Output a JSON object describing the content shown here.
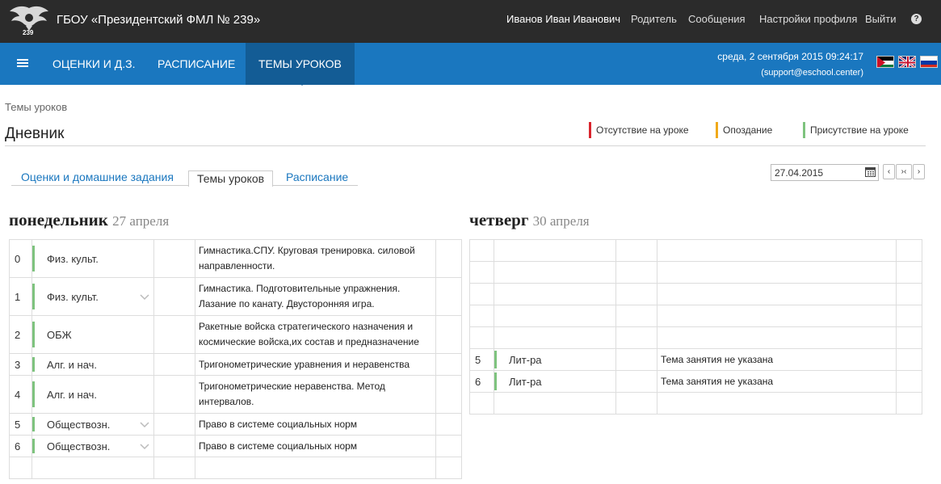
{
  "header": {
    "school_name": "ГБОУ «Президентский ФМЛ № 239»",
    "user_name": "Иванов Иван Иванович",
    "role": "Родитель",
    "messages": "Сообщения",
    "settings": "Настройки профиля",
    "logout": "Выйти",
    "help": "?",
    "logo_text": "239"
  },
  "nav": {
    "items": [
      "ОЦЕНКИ И Д.З.",
      "РАСПИСАНИЕ",
      "ТЕМЫ УРОКОВ"
    ],
    "active": "ТЕМЫ УРОКОВ",
    "datetime": "среда, 2 сентября 2015 09:24:17",
    "support": "(support@eschool.center)"
  },
  "page": {
    "breadcrumb": "Темы уроков",
    "title": "Дневник",
    "legend": [
      {
        "label": "Отсутствие на уроке",
        "color": "#d9252e"
      },
      {
        "label": "Опоздание",
        "color": "#f0a91a"
      },
      {
        "label": "Присутствие на уроке",
        "color": "#7ec37e"
      }
    ],
    "tabs": [
      "Оценки и домашние задания",
      "Темы уроков",
      "Расписание"
    ],
    "active_tab": "Темы уроков",
    "date_value": "27.04.2015",
    "prev_label": "‹",
    "today_label": "›‹",
    "next_label": "›"
  },
  "days": [
    {
      "day_name": "понедельник",
      "date": "27 апреля",
      "lessons": [
        {
          "num": "0",
          "subject": "Физ. культ.",
          "topic": "Гимнастика.СПУ. Круговая тренировка. силовой направленности.",
          "chevron": false
        },
        {
          "num": "1",
          "subject": "Физ. культ.",
          "topic": "Гимнастика. Подготовительные упражнения. Лазание по канату. Двусторонняя игра.",
          "chevron": true
        },
        {
          "num": "2",
          "subject": "ОБЖ",
          "topic": "Ракетные войска стратегического назначения и космические войска,их состав и предназначение",
          "chevron": false
        },
        {
          "num": "3",
          "subject": "Алг. и нач.",
          "topic": "Тригонометрические уравнения и неравенства",
          "chevron": false
        },
        {
          "num": "4",
          "subject": "Алг. и нач.",
          "topic": "Тригонометрические неравенства. Метод интервалов.",
          "chevron": false
        },
        {
          "num": "5",
          "subject": "Обществозн.",
          "topic": "Право в системе социальных норм",
          "chevron": true
        },
        {
          "num": "6",
          "subject": "Обществозн.",
          "topic": "Право в системе социальных норм",
          "chevron": true
        }
      ]
    },
    {
      "day_name": "четверг",
      "date": "30 апреля",
      "lessons": [
        {
          "num": "5",
          "subject": "Лит-ра",
          "topic": "Тема занятия не указана"
        },
        {
          "num": "6",
          "subject": "Лит-ра",
          "topic": "Тема занятия не указана"
        }
      ]
    }
  ],
  "colors": {
    "topbar": "#2b2b2b",
    "navbar": "#1a77bf",
    "nav_active": "#135c95",
    "present": "#7ec37e"
  }
}
